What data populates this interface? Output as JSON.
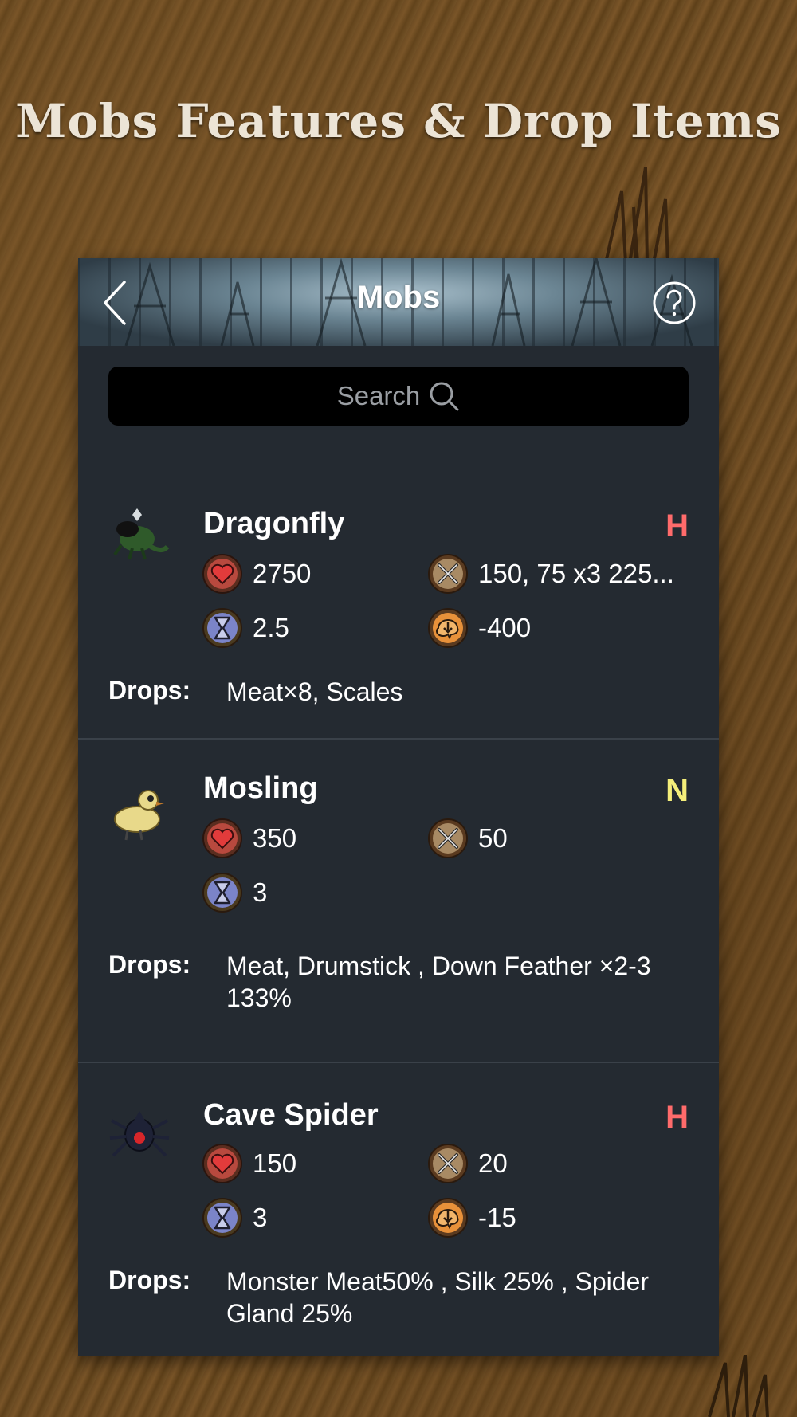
{
  "heading": "Mobs Features & Drop Items",
  "nav": {
    "title": "Mobs"
  },
  "search": {
    "placeholder": "Search"
  },
  "drops_label": "Drops:",
  "tag_colors": {
    "H": "#ff6b6b",
    "N": "#f4ee7a"
  },
  "mobs": [
    {
      "name": "Dragonfly",
      "tag": "H",
      "health": "2750",
      "damage": "150, 75 x3 225...",
      "attack_period": "2.5",
      "sanity": "-400",
      "drops": "Meat×8, Scales"
    },
    {
      "name": "Mosling",
      "tag": "N",
      "health": "350",
      "damage": "50",
      "attack_period": "3",
      "drops": "Meat, Drumstick , Down Feather ×2-3 133%"
    },
    {
      "name": "Cave Spider",
      "tag": "H",
      "health": "150",
      "damage": "20",
      "attack_period": "3",
      "sanity": "-15",
      "drops": "Monster Meat50% , Silk 25% , Spider Gland 25%"
    }
  ]
}
